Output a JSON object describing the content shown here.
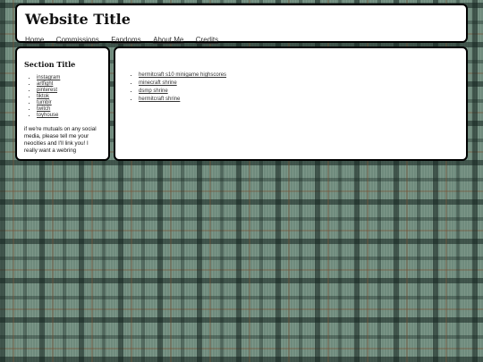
{
  "header": {
    "title": "Website Title",
    "nav": [
      "Home",
      "Commissions",
      "Fandoms",
      "About Me",
      "Credits"
    ]
  },
  "sidebar": {
    "heading": "Section Title",
    "links": [
      "instagram",
      "artfight",
      "pinterest",
      "tiktok",
      "tumblr",
      "twitch",
      "toyhouse"
    ],
    "note": "if we're mutuals on any social media, please tell me your neocities and I'll link you! I really want a webring"
  },
  "main": {
    "links": [
      "hermitcraft s10 minigame highscores",
      "minecraft shrine",
      "dsmp shrine",
      "hermitcraft shrine"
    ]
  },
  "colors": {
    "background": "#6f8b7d",
    "panel": "#ffffff",
    "border": "#000000"
  }
}
